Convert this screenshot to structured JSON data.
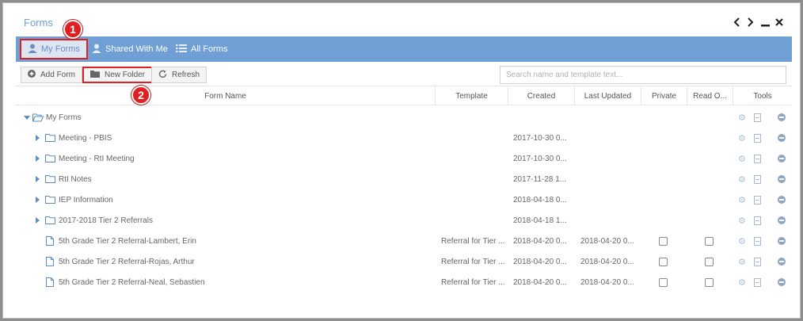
{
  "window": {
    "title": "Forms"
  },
  "tabs": [
    {
      "label": "My Forms",
      "icon": "user-icon",
      "active": true
    },
    {
      "label": "Shared With Me",
      "icon": "user-icon"
    },
    {
      "label": "All Forms",
      "icon": "list-icon"
    }
  ],
  "toolbar": {
    "add_form": "Add Form",
    "new_folder": "New Folder",
    "refresh": "Refresh",
    "search_placeholder": "Search name and template text..."
  },
  "columns": [
    "Form Name",
    "Template",
    "Created",
    "Last Updated",
    "Private",
    "Read O...",
    "Tools"
  ],
  "root_folder": "My Forms",
  "folders": [
    {
      "name": "Meeting - PBIS",
      "created": "2017-10-30 0..."
    },
    {
      "name": "Meeting - RtI Meeting",
      "created": "2017-10-30 0..."
    },
    {
      "name": "RtI Notes",
      "created": "2017-11-28 1..."
    },
    {
      "name": "IEP Information",
      "created": "2018-04-18 0..."
    },
    {
      "name": "2017-2018 Tier 2 Referrals",
      "created": "2018-04-18 1..."
    }
  ],
  "forms": [
    {
      "name": "5th Grade Tier 2 Referral-Lambert, Erin",
      "template": "Referral for Tier ...",
      "created": "2018-04-20 0...",
      "updated": "2018-04-20 0..."
    },
    {
      "name": "5th Grade Tier 2 Referral-Rojas, Arthur",
      "template": "Referral for Tier ...",
      "created": "2018-04-20 0...",
      "updated": "2018-04-20 0..."
    },
    {
      "name": "5th Grade Tier 2 Referral-Neal, Sebastien",
      "template": "Referral for Tier ...",
      "created": "2018-04-20 0...",
      "updated": "2018-04-20 0..."
    }
  ],
  "callouts": [
    "1",
    "2"
  ],
  "colors": {
    "accent": "#6f9fd5",
    "highlight": "#e02020"
  }
}
